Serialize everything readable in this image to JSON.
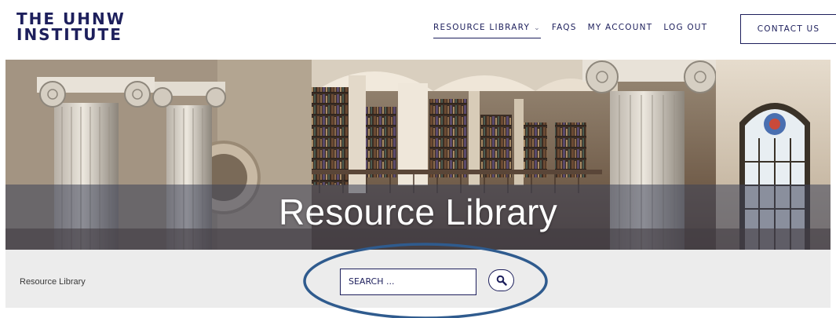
{
  "header": {
    "logo_line1": "THE UHNW",
    "logo_line2": "INSTITUTE",
    "nav": [
      {
        "label": "RESOURCE LIBRARY",
        "active": true,
        "has_dropdown": true
      },
      {
        "label": "FAQS"
      },
      {
        "label": "MY ACCOUNT"
      },
      {
        "label": "LOG OUT"
      }
    ],
    "contact_label": "CONTACT US"
  },
  "hero": {
    "title": "Resource Library"
  },
  "subbar": {
    "breadcrumb": "Resource Library",
    "search_placeholder": "SEARCH ...",
    "search_icon": "search-icon"
  },
  "colors": {
    "brand_navy": "#1d1f5c",
    "subbar_bg": "#ececec",
    "annotation_ellipse": "#2f5b8e"
  }
}
